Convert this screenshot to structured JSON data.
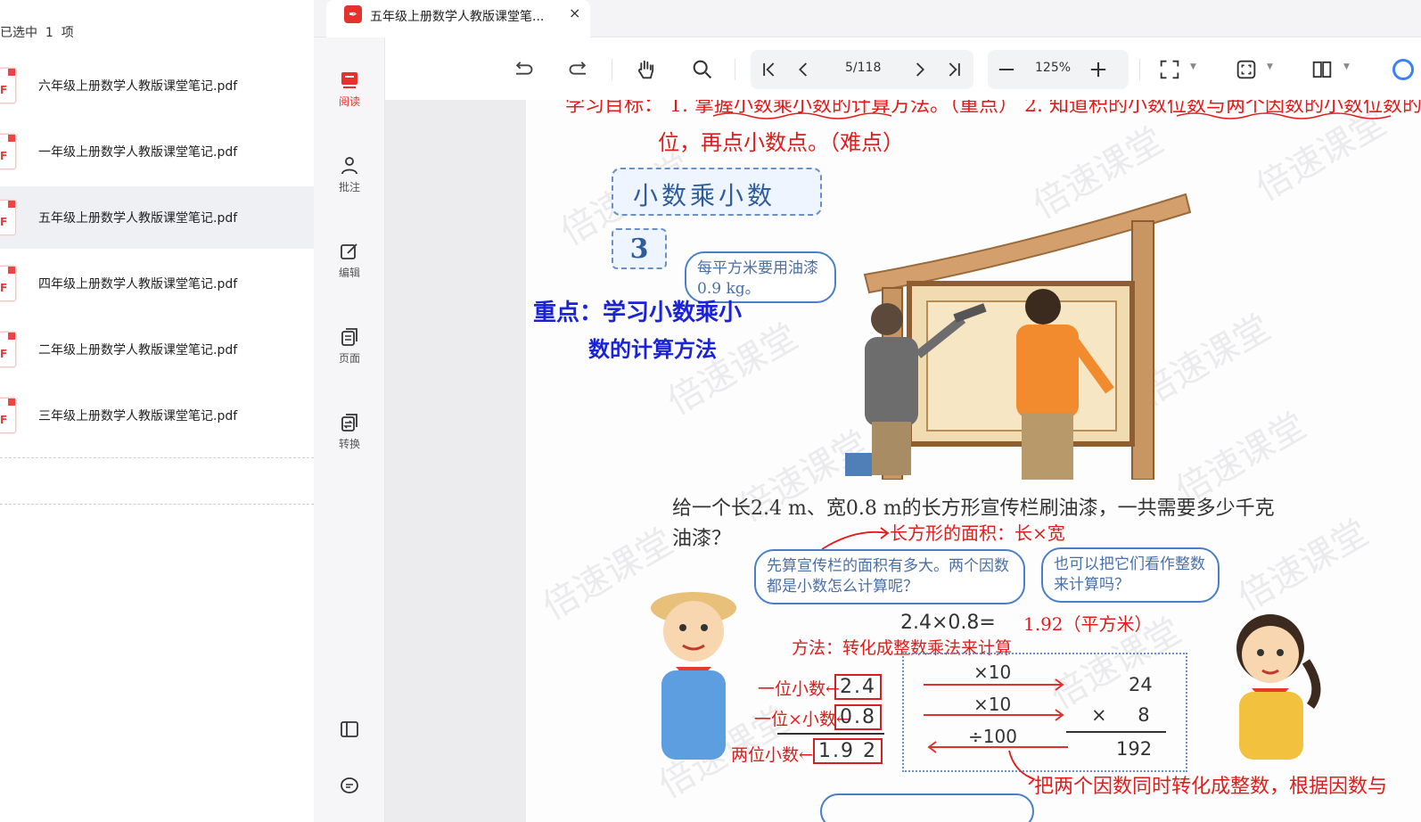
{
  "file_panel": {
    "selection_status": "已选中  1  项",
    "pdf_badge": "F",
    "files": [
      {
        "name": "六年级上册数学人教版课堂笔记.pdf",
        "selected": false
      },
      {
        "name": "一年级上册数学人教版课堂笔记.pdf",
        "selected": false
      },
      {
        "name": "五年级上册数学人教版课堂笔记.pdf",
        "selected": true
      },
      {
        "name": "四年级上册数学人教版课堂笔记.pdf",
        "selected": false
      },
      {
        "name": "二年级上册数学人教版课堂笔记.pdf",
        "selected": false
      },
      {
        "name": "三年级上册数学人教版课堂笔记.pdf",
        "selected": false
      }
    ]
  },
  "tab": {
    "title": "五年级上册数学人教版课堂笔...",
    "close_icon": "×"
  },
  "sidebar": {
    "items": [
      {
        "label": "阅读",
        "icon": "read-icon",
        "active": true
      },
      {
        "label": "批注",
        "icon": "annotate-icon",
        "active": false
      },
      {
        "label": "编辑",
        "icon": "edit-icon",
        "active": false
      },
      {
        "label": "页面",
        "icon": "pages-icon",
        "active": false
      },
      {
        "label": "转换",
        "icon": "convert-icon",
        "active": false
      }
    ]
  },
  "toolbar": {
    "page_indicator": "5/118",
    "zoom_level": "125%"
  },
  "document": {
    "top_line": "学习目标： 1. 掌握小数乘小数的计算方法。（重点） 2. 知道积的小数位数与两个因数的小数位数的关系",
    "line2": "位，再点小数点。（难点）",
    "section_title": "小数乘小数",
    "example_number": "3",
    "speech_paint": "每平方米要用油漆 0.9 kg。",
    "note_focus_1": "重点：学习小数乘小",
    "note_focus_2": "数的计算方法",
    "problem_1": "给一个长2.4 m、宽0.8 m的长方形宣传栏刷油漆，一共需要多少千克",
    "problem_2": "油漆？",
    "note_area": "长方形的面积：长×宽",
    "bubble_left": "先算宣传栏的面积有多大。两个因数都是小数怎么计算呢？",
    "bubble_right": "也可以把它们看作整数来计算吗？",
    "equation": "2.4×0.8=",
    "answer": "1.92（平方米）",
    "method": "方法：转化成整数乘法来计算",
    "label_one_decimal": "一位小数←",
    "label_one_decimal_2": "一位×小数←",
    "label_two_decimal": "两位小数←",
    "box_a": "2.4",
    "box_b": "0.8",
    "box_c": "1.9 2",
    "op_1": "×10",
    "op_2": "×10",
    "op_3": "÷100",
    "int_a": "24",
    "int_b": "× 8",
    "int_c": "192",
    "bottom_note": "把两个因数同时转化成整数，根据因数与",
    "watermark": "倍速课堂"
  }
}
